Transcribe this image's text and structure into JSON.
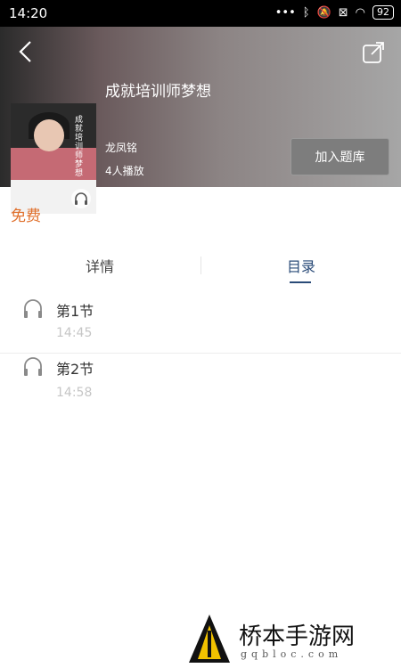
{
  "status_bar": {
    "time": "14:20",
    "battery": "92"
  },
  "header": {
    "title": "成就培训师梦想",
    "author": "龙凤铭",
    "plays": "4人播放",
    "add_button": "加入题库",
    "cover_text": "成就培训师梦想"
  },
  "price": "免费",
  "tabs": [
    {
      "label": "详情",
      "active": false
    },
    {
      "label": "目录",
      "active": true
    }
  ],
  "episodes": [
    {
      "title": "第1节",
      "duration": "14:45"
    },
    {
      "title": "第2节",
      "duration": "14:58"
    }
  ],
  "watermark": {
    "name": "桥本手游网",
    "url": "gqbloc.com"
  },
  "colors": {
    "accent_orange": "#e0702c",
    "tab_active": "#2a4b78",
    "duration_gray": "#c6c6c6"
  }
}
